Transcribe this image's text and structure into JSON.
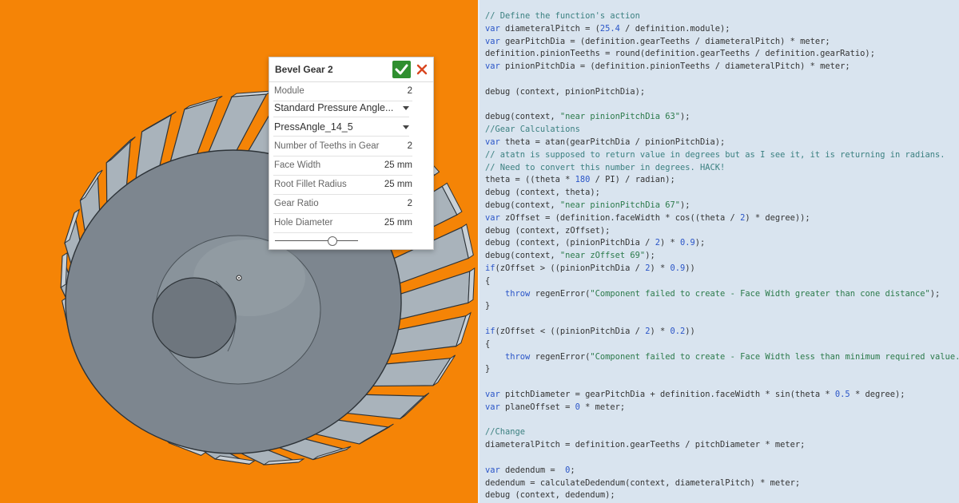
{
  "colors": {
    "viewport_bg": "#f58406",
    "gear_body": "#7d868f",
    "tooth": "#a9b3bb",
    "code_bg": "#d9e4ef",
    "keyword": "#2a55c8",
    "comment": "#3b8080",
    "string": "#2b7a4a",
    "ok": "#2f8f2f",
    "cancel": "#d9451f"
  },
  "dialog": {
    "title": "Bevel Gear 2",
    "ok_icon": "check-icon",
    "cancel_icon": "close-icon",
    "module_label": "Module",
    "module_value": "2",
    "pressure_angle_type": "Standard Pressure Angle...",
    "pressure_angle": "PressAngle_14_5",
    "teeth_label": "Number of Teeths in Gear",
    "teeth_value": "2",
    "face_width_label": "Face Width",
    "face_width_value": "25 mm",
    "fillet_label": "Root Fillet Radius",
    "fillet_value": "25 mm",
    "ratio_label": "Gear Ratio",
    "ratio_value": "2",
    "hole_label": "Hole Diameter",
    "hole_value": "25 mm"
  },
  "code_lines": [
    [
      [
        "c",
        "// Define the function's action"
      ]
    ],
    [
      [
        "k",
        "var "
      ],
      [
        "t",
        "diameteralPitch = ("
      ],
      [
        "n",
        "25.4"
      ],
      [
        "t",
        " / definition.module);"
      ]
    ],
    [
      [
        "k",
        "var "
      ],
      [
        "t",
        "gearPitchDia = (definition.gearTeeths / diameteralPitch) * meter;"
      ]
    ],
    [
      [
        "t",
        "definition.pinionTeeths = round(definition.gearTeeths / definition.gearRatio);"
      ]
    ],
    [
      [
        "k",
        "var "
      ],
      [
        "t",
        "pinionPitchDia = (definition.pinionTeeths / diameteralPitch) * meter;"
      ]
    ],
    [],
    [
      [
        "t",
        "debug (context, pinionPitchDia);"
      ]
    ],
    [],
    [
      [
        "t",
        "debug(context, "
      ],
      [
        "s",
        "\"near pinionPitchDia 63\""
      ],
      [
        "t",
        ");"
      ]
    ],
    [
      [
        "c",
        "//Gear Calculations"
      ]
    ],
    [
      [
        "k",
        "var "
      ],
      [
        "t",
        "theta = atan(gearPitchDia / pinionPitchDia);"
      ]
    ],
    [
      [
        "c",
        "// atatn is supposed to return value in degrees but as I see it, it is returning in radians."
      ]
    ],
    [
      [
        "c",
        "// Need to convert this number in degrees. HACK!"
      ]
    ],
    [
      [
        "t",
        "theta = ((theta * "
      ],
      [
        "n",
        "180"
      ],
      [
        "t",
        " / PI) / radian);"
      ]
    ],
    [
      [
        "t",
        "debug (context, theta);"
      ]
    ],
    [
      [
        "t",
        "debug(context, "
      ],
      [
        "s",
        "\"near pinionPitchDia 67\""
      ],
      [
        "t",
        ");"
      ]
    ],
    [
      [
        "k",
        "var "
      ],
      [
        "t",
        "zOffset = (definition.faceWidth * cos((theta / "
      ],
      [
        "n",
        "2"
      ],
      [
        "t",
        ") * degree));"
      ]
    ],
    [
      [
        "t",
        "debug (context, zOffset);"
      ]
    ],
    [
      [
        "t",
        "debug (context, (pinionPitchDia / "
      ],
      [
        "n",
        "2"
      ],
      [
        "t",
        ") * "
      ],
      [
        "n",
        "0.9"
      ],
      [
        "t",
        ");"
      ]
    ],
    [
      [
        "t",
        "debug(context, "
      ],
      [
        "s",
        "\"near zOffset 69\""
      ],
      [
        "t",
        ");"
      ]
    ],
    [
      [
        "k",
        "if"
      ],
      [
        "t",
        "(zOffset > ((pinionPitchDia / "
      ],
      [
        "n",
        "2"
      ],
      [
        "t",
        ") * "
      ],
      [
        "n",
        "0.9"
      ],
      [
        "t",
        "))"
      ]
    ],
    [
      [
        "t",
        "{"
      ]
    ],
    [
      [
        "t",
        "    "
      ],
      [
        "k",
        "throw "
      ],
      [
        "t",
        "regenError("
      ],
      [
        "s",
        "\"Component failed to create - Face Width greater than cone distance\""
      ],
      [
        "t",
        ");"
      ]
    ],
    [
      [
        "t",
        "}"
      ]
    ],
    [],
    [
      [
        "k",
        "if"
      ],
      [
        "t",
        "(zOffset < ((pinionPitchDia / "
      ],
      [
        "n",
        "2"
      ],
      [
        "t",
        ") * "
      ],
      [
        "n",
        "0.2"
      ],
      [
        "t",
        "))"
      ]
    ],
    [
      [
        "t",
        "{"
      ]
    ],
    [
      [
        "t",
        "    "
      ],
      [
        "k",
        "throw "
      ],
      [
        "t",
        "regenError("
      ],
      [
        "s",
        "\"Component failed to create - Face Width less than minimum required value.\""
      ],
      [
        "t",
        ");"
      ]
    ],
    [
      [
        "t",
        "}"
      ]
    ],
    [],
    [
      [
        "k",
        "var "
      ],
      [
        "t",
        "pitchDiameter = gearPitchDia + definition.faceWidth * sin(theta * "
      ],
      [
        "n",
        "0.5"
      ],
      [
        "t",
        " * degree);"
      ]
    ],
    [
      [
        "k",
        "var "
      ],
      [
        "t",
        "planeOffset = "
      ],
      [
        "n",
        "0"
      ],
      [
        "t",
        " * meter;"
      ]
    ],
    [],
    [
      [
        "c",
        "//Change"
      ]
    ],
    [
      [
        "t",
        "diameteralPitch = definition.gearTeeths / pitchDiameter * meter;"
      ]
    ],
    [],
    [
      [
        "k",
        "var "
      ],
      [
        "t",
        "dedendum =  "
      ],
      [
        "n",
        "0"
      ],
      [
        "t",
        ";"
      ]
    ],
    [
      [
        "t",
        "dedendum = calculateDedendum(context, diameteralPitch) * meter;"
      ]
    ],
    [
      [
        "t",
        "debug (context, dedendum);"
      ]
    ]
  ]
}
